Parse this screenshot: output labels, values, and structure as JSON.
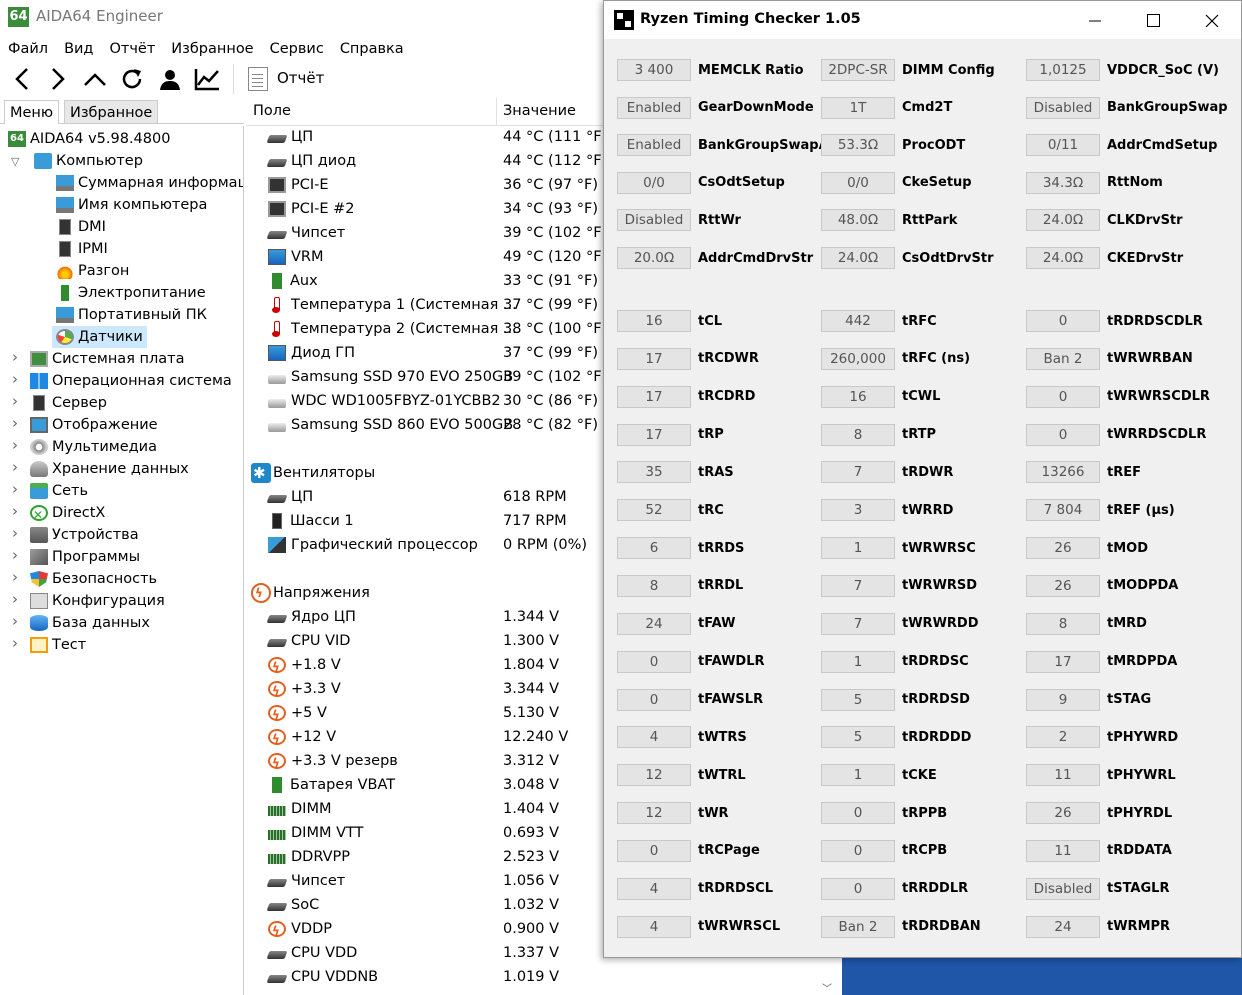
{
  "aida": {
    "title": "AIDA64 Engineer",
    "logo": "64",
    "menu": [
      "Файл",
      "Вид",
      "Отчёт",
      "Избранное",
      "Сервис",
      "Справка"
    ],
    "toolbar": {
      "report_label": "Отчёт"
    },
    "tabs": {
      "menu": "Меню",
      "favorites": "Избранное"
    },
    "tree": {
      "root": "AIDA64 v5.98.4800",
      "computer": "Компьютер",
      "computer_children": [
        "Суммарная информация",
        "Имя компьютера",
        "DMI",
        "IPMI",
        "Разгон",
        "Электропитание",
        "Портативный ПК",
        "Датчики"
      ],
      "sections": [
        "Системная плата",
        "Операционная система",
        "Сервер",
        "Отображение",
        "Мультимедиа",
        "Хранение данных",
        "Сеть",
        "DirectX",
        "Устройства",
        "Программы",
        "Безопасность",
        "Конфигурация",
        "База данных",
        "Тест"
      ]
    },
    "list": {
      "header_field": "Поле",
      "header_value": "Значение",
      "temps": [
        {
          "icon": "chip-icon",
          "field": "ЦП",
          "value": "44 °C  (111 °F)"
        },
        {
          "icon": "chip-icon",
          "field": "ЦП диод",
          "value": "44 °C  (112 °F)"
        },
        {
          "icon": "pcb-icon",
          "field": "PCI-E",
          "value": "36 °C  (97 °F)"
        },
        {
          "icon": "pcb-icon",
          "field": "PCI-E #2",
          "value": "34 °C  (93 °F)"
        },
        {
          "icon": "chip-icon",
          "field": "Чипсет",
          "value": "39 °C  (102 °F)"
        },
        {
          "icon": "monitor-icon",
          "field": "VRM",
          "value": "49 °C  (120 °F)"
        },
        {
          "icon": "green-bar-icon",
          "field": "Aux",
          "value": "33 °C  (91 °F)"
        },
        {
          "icon": "thermometer-icon",
          "field": "Температура 1 (Системная ...",
          "value": "37 °C  (99 °F)"
        },
        {
          "icon": "thermometer-icon",
          "field": "Температура 2 (Системная ...",
          "value": "38 °C  (100 °F)"
        },
        {
          "icon": "monitor-icon",
          "field": "Диод ГП",
          "value": "37 °C  (99 °F)"
        },
        {
          "icon": "disk-icon",
          "field": "Samsung SSD 970 EVO 250GB",
          "value": "39 °C  (102 °F)"
        },
        {
          "icon": "disk-icon",
          "field": "WDC WD1005FBYZ-01YCBB2",
          "value": "30 °C  (86 °F)"
        },
        {
          "icon": "disk-icon",
          "field": "Samsung SSD 860 EVO 500GB",
          "value": "28 °C  (82 °F)"
        }
      ],
      "fans_group": "Вентиляторы",
      "fans": [
        {
          "icon": "chip-icon",
          "field": "ЦП",
          "value": "618 RPM"
        },
        {
          "icon": "case-icon",
          "field": "Шасси 1",
          "value": "717 RPM"
        },
        {
          "icon": "gpu-icon",
          "field": "Графический процессор",
          "value": "0 RPM  (0%)"
        }
      ],
      "volt_group": "Напряжения",
      "volts": [
        {
          "icon": "chip-icon",
          "field": "Ядро ЦП",
          "value": "1.344 V"
        },
        {
          "icon": "chip-icon",
          "field": "CPU VID",
          "value": "1.300 V"
        },
        {
          "icon": "voltage-icon",
          "field": "+1.8 V",
          "value": "1.804 V"
        },
        {
          "icon": "voltage-icon",
          "field": "+3.3 V",
          "value": "3.344 V"
        },
        {
          "icon": "voltage-icon",
          "field": "+5 V",
          "value": "5.130 V"
        },
        {
          "icon": "voltage-icon",
          "field": "+12 V",
          "value": "12.240 V"
        },
        {
          "icon": "voltage-icon",
          "field": "+3.3 V резерв",
          "value": "3.312 V"
        },
        {
          "icon": "green-bar-icon",
          "field": "Батарея VBAT",
          "value": "3.048 V"
        },
        {
          "icon": "ram-icon",
          "field": "DIMM",
          "value": "1.404 V"
        },
        {
          "icon": "ram-icon",
          "field": "DIMM VTT",
          "value": "0.693 V"
        },
        {
          "icon": "ram-icon",
          "field": "DDRVPP",
          "value": "2.523 V"
        },
        {
          "icon": "chip-icon",
          "field": "Чипсет",
          "value": "1.056 V"
        },
        {
          "icon": "chip-icon",
          "field": "SoC",
          "value": "1.032 V"
        },
        {
          "icon": "voltage-icon",
          "field": "VDDP",
          "value": "0.900 V"
        },
        {
          "icon": "chip-icon",
          "field": "CPU VDD",
          "value": "1.337 V"
        },
        {
          "icon": "chip-icon",
          "field": "CPU VDDNB",
          "value": "1.019 V"
        }
      ]
    }
  },
  "ryzen": {
    "title": "Ryzen Timing Checker 1.05",
    "top_rows": [
      [
        {
          "v": "3 400",
          "l": "MEMCLK Ratio"
        },
        {
          "v": "2DPC-SR",
          "l": "DIMM Config"
        },
        {
          "v": "1,0125",
          "l": "VDDCR_SoC (V)"
        }
      ],
      [
        {
          "v": "Enabled",
          "l": "GearDownMode"
        },
        {
          "v": "1T",
          "l": "Cmd2T"
        },
        {
          "v": "Disabled",
          "l": "BankGroupSwap"
        }
      ],
      [
        {
          "v": "Enabled",
          "l": "BankGroupSwapAlt"
        },
        {
          "v": "53.3Ω",
          "l": "ProcODT"
        },
        {
          "v": "0/11",
          "l": "AddrCmdSetup"
        }
      ],
      [
        {
          "v": "0/0",
          "l": "CsOdtSetup"
        },
        {
          "v": "0/0",
          "l": "CkeSetup"
        },
        {
          "v": "34.3Ω",
          "l": "RttNom"
        }
      ],
      [
        {
          "v": "Disabled",
          "l": "RttWr"
        },
        {
          "v": "48.0Ω",
          "l": "RttPark"
        },
        {
          "v": "24.0Ω",
          "l": "CLKDrvStr"
        }
      ],
      [
        {
          "v": "20.0Ω",
          "l": "AddrCmdDrvStr"
        },
        {
          "v": "24.0Ω",
          "l": "CsOdtDrvStr"
        },
        {
          "v": "24.0Ω",
          "l": "CKEDrvStr"
        }
      ]
    ],
    "timing_rows": [
      [
        {
          "v": "16",
          "l": "tCL"
        },
        {
          "v": "442",
          "l": "tRFC"
        },
        {
          "v": "0",
          "l": "tRDRDSCDLR"
        }
      ],
      [
        {
          "v": "17",
          "l": "tRCDWR"
        },
        {
          "v": "260,000",
          "l": "tRFC (ns)"
        },
        {
          "v": "Ban 2",
          "l": "tWRWRBAN"
        }
      ],
      [
        {
          "v": "17",
          "l": "tRCDRD"
        },
        {
          "v": "16",
          "l": "tCWL"
        },
        {
          "v": "0",
          "l": "tWRWRSCDLR"
        }
      ],
      [
        {
          "v": "17",
          "l": "tRP"
        },
        {
          "v": "8",
          "l": "tRTP"
        },
        {
          "v": "0",
          "l": "tWRRDSCDLR"
        }
      ],
      [
        {
          "v": "35",
          "l": "tRAS"
        },
        {
          "v": "7",
          "l": "tRDWR"
        },
        {
          "v": "13266",
          "l": "tREF"
        }
      ],
      [
        {
          "v": "52",
          "l": "tRC"
        },
        {
          "v": "3",
          "l": "tWRRD"
        },
        {
          "v": "7 804",
          "l": "tREF (µs)"
        }
      ],
      [
        {
          "v": "6",
          "l": "tRRDS"
        },
        {
          "v": "1",
          "l": "tWRWRSC"
        },
        {
          "v": "26",
          "l": "tMOD"
        }
      ],
      [
        {
          "v": "8",
          "l": "tRRDL"
        },
        {
          "v": "7",
          "l": "tWRWRSD"
        },
        {
          "v": "26",
          "l": "tMODPDA"
        }
      ],
      [
        {
          "v": "24",
          "l": "tFAW"
        },
        {
          "v": "7",
          "l": "tWRWRDD"
        },
        {
          "v": "8",
          "l": "tMRD"
        }
      ],
      [
        {
          "v": "0",
          "l": "tFAWDLR"
        },
        {
          "v": "1",
          "l": "tRDRDSC"
        },
        {
          "v": "17",
          "l": "tMRDPDA"
        }
      ],
      [
        {
          "v": "0",
          "l": "tFAWSLR"
        },
        {
          "v": "5",
          "l": "tRDRDSD"
        },
        {
          "v": "9",
          "l": "tSTAG"
        }
      ],
      [
        {
          "v": "4",
          "l": "tWTRS"
        },
        {
          "v": "5",
          "l": "tRDRDDD"
        },
        {
          "v": "2",
          "l": "tPHYWRD"
        }
      ],
      [
        {
          "v": "12",
          "l": "tWTRL"
        },
        {
          "v": "1",
          "l": "tCKE"
        },
        {
          "v": "11",
          "l": "tPHYWRL"
        }
      ],
      [
        {
          "v": "12",
          "l": "tWR"
        },
        {
          "v": "0",
          "l": "tRPPB"
        },
        {
          "v": "26",
          "l": "tPHYRDL"
        }
      ],
      [
        {
          "v": "0",
          "l": "tRCPage"
        },
        {
          "v": "0",
          "l": "tRCPB"
        },
        {
          "v": "11",
          "l": "tRDDATA"
        }
      ],
      [
        {
          "v": "4",
          "l": "tRDRDSCL"
        },
        {
          "v": "0",
          "l": "tRRDDLR"
        },
        {
          "v": "Disabled",
          "l": "tSTAGLR"
        }
      ],
      [
        {
          "v": "4",
          "l": "tWRWRSCL"
        },
        {
          "v": "Ban 2",
          "l": "tRDRDBAN"
        },
        {
          "v": "24",
          "l": "tWRMPR"
        }
      ]
    ]
  }
}
